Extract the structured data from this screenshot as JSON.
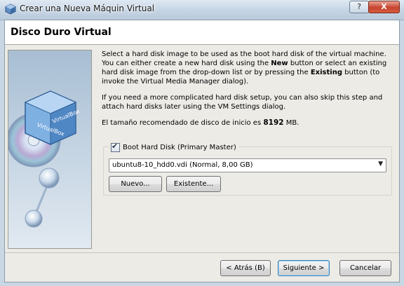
{
  "window": {
    "title": "Crear una Nueva Máquin Virtual",
    "help_label": "?",
    "close_label": "X"
  },
  "header": {
    "title": "Disco Duro Virtual"
  },
  "content": {
    "p1_a": "Select a hard disk image to be used as the boot hard disk of the virtual machine. You can either create a new hard disk using the ",
    "p1_new": "New",
    "p1_b": " button or select an existing hard disk image from the drop-down list or by pressing the ",
    "p1_existing": "Existing",
    "p1_c": " button (to invoke the Virtual Media Manager dialog).",
    "p2": "If you need a more complicated hard disk setup, you can also skip this step and attach hard disks later using the VM Settings dialog.",
    "rec_prefix": "El tamaño recomendado de disco de inicio es ",
    "rec_value": "8192",
    "rec_unit": " MB."
  },
  "boot_disk": {
    "checkbox_label": "Boot Hard Disk (Primary Master)",
    "checked": true,
    "selected_disk": "ubuntu8-10_hdd0.vdi (Normal, 8,00 GB)",
    "new_button": "Nuevo...",
    "existing_button": "Existente..."
  },
  "footer": {
    "back_button": "< Atrás (B)",
    "next_button": "Siguiente >",
    "cancel_button": "Cancelar"
  },
  "icons": {
    "app": "virtualbox-icon",
    "side": "virtualbox-cube-disc-illustration"
  }
}
